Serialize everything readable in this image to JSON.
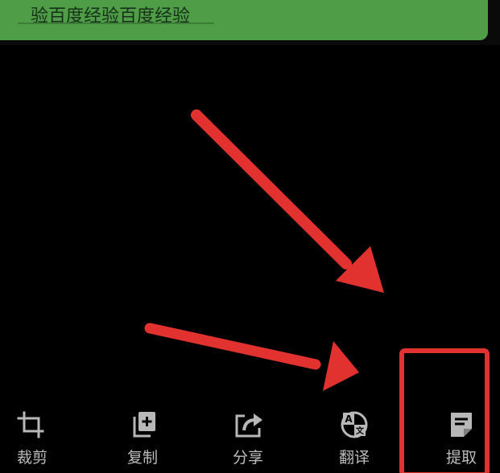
{
  "preview": {
    "text": "验百度经验百度经验",
    "card_color": "#4f9d47"
  },
  "toolbar": {
    "items": [
      {
        "id": "crop",
        "label": "裁剪",
        "icon": "crop-icon"
      },
      {
        "id": "copy",
        "label": "复制",
        "icon": "copy-icon"
      },
      {
        "id": "share",
        "label": "分享",
        "icon": "share-icon"
      },
      {
        "id": "translate",
        "label": "翻译",
        "icon": "translate-icon"
      },
      {
        "id": "extract",
        "label": "提取",
        "icon": "extract-text-icon"
      }
    ]
  },
  "annotations": {
    "color": "#e2322f",
    "arrow_count": 2,
    "highlighted_item": "提取"
  }
}
